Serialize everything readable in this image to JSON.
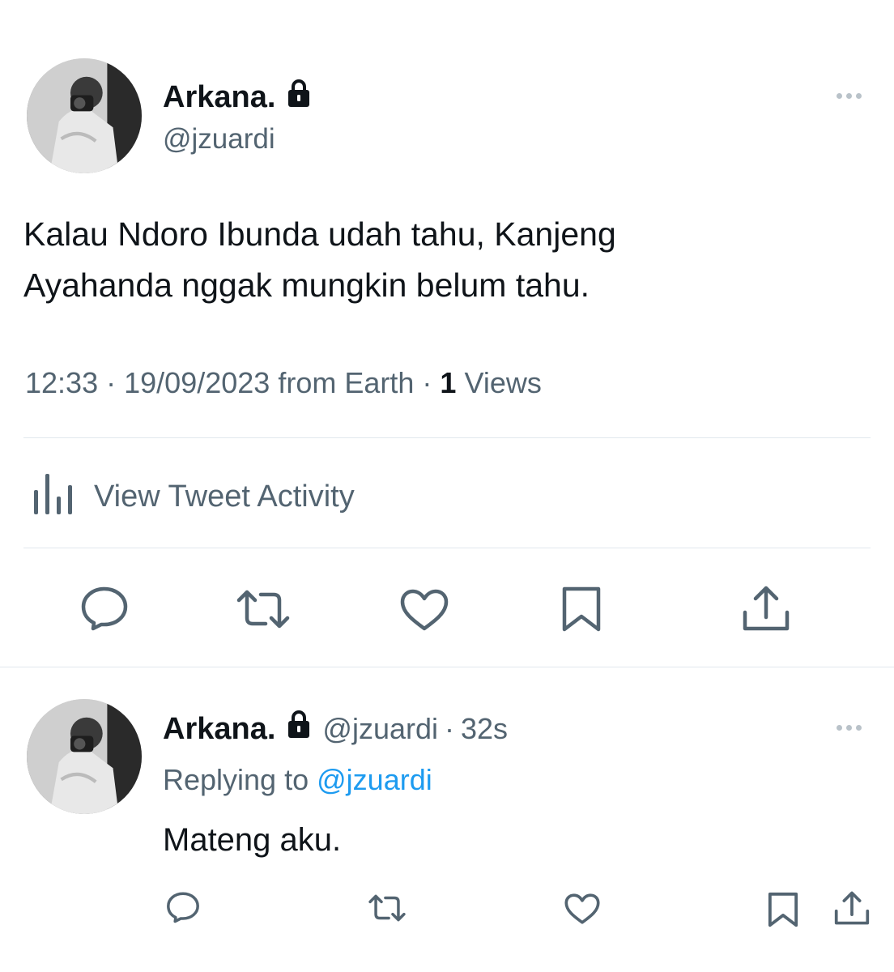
{
  "main_tweet": {
    "display_name": "Arkana.",
    "handle": "@jzuardi",
    "text_line1": "Kalau Ndoro Ibunda udah tahu, Kanjeng",
    "text_line2": "Ayahanda nggak mungkin belum tahu.",
    "time": "12:33",
    "date": "19/09/2023",
    "source": "from Earth",
    "views_count": "1",
    "views_label": "Views",
    "separator": "·",
    "activity_label": "View Tweet Activity"
  },
  "reply": {
    "display_name": "Arkana.",
    "handle": "@jzuardi",
    "separator": "·",
    "time_ago": "32s",
    "replying_prefix": "Replying to",
    "replying_handle": "@jzuardi",
    "text": "Mateng aku."
  },
  "colors": {
    "text_primary": "#0f1419",
    "text_secondary": "#536471",
    "link": "#1d9bf0",
    "divider": "#e1e8ed",
    "icon": "#536471"
  },
  "icons": {
    "lock": "lock-icon",
    "more": "more-horizontal-icon",
    "analytics": "bar-chart-icon",
    "reply": "reply-icon",
    "retweet": "retweet-icon",
    "like": "heart-icon",
    "bookmark": "bookmark-icon",
    "share": "share-icon"
  }
}
